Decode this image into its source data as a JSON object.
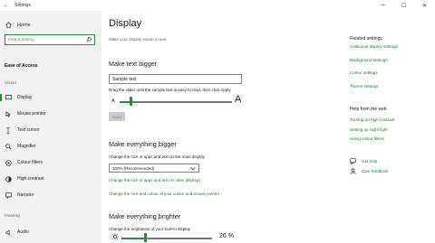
{
  "window": {
    "title": "Settings",
    "back_glyph": "←",
    "minimize_glyph": "—",
    "maximize_glyph": "☐",
    "close_glyph": "✕"
  },
  "sidebar": {
    "home_label": "Home",
    "search_placeholder": "Find a setting",
    "section_title": "Ease of Access",
    "groups": [
      {
        "label": "Vision"
      },
      {
        "label": "Hearing"
      }
    ],
    "items": [
      {
        "label": "Display",
        "icon": "display-icon",
        "active": true
      },
      {
        "label": "Mouse pointer",
        "icon": "mouse-pointer-icon"
      },
      {
        "label": "Text cursor",
        "icon": "text-cursor-icon"
      },
      {
        "label": "Magnifier",
        "icon": "magnifier-icon"
      },
      {
        "label": "Colour filters",
        "icon": "colour-filters-icon"
      },
      {
        "label": "High contrast",
        "icon": "high-contrast-icon"
      },
      {
        "label": "Narrator",
        "icon": "narrator-icon"
      },
      {
        "label": "Audio",
        "icon": "audio-icon"
      }
    ]
  },
  "main": {
    "title": "Display",
    "subtitle": "Make your display easier to see.",
    "text_bigger": {
      "heading": "Make text bigger",
      "sample_text": "Sample text",
      "instruction": "Drag the slider until the sample text is easy to read, then click Apply",
      "small_a": "A",
      "big_a": "A",
      "slider_percent": 10,
      "apply_label": "Apply"
    },
    "everything_bigger": {
      "heading": "Make everything bigger",
      "label": "Change the size of apps and text on the main display",
      "dropdown_value": "100% (Recommended)",
      "link1": "Change the size of apps and text on other displays",
      "link2": "Change the size and colour of your cursor and mouse pointer"
    },
    "everything_brighter": {
      "heading": "Make everything brighter",
      "label": "Change the brightness of your built-in display",
      "brightness_percent": 26,
      "brightness_text": "26 %"
    }
  },
  "right": {
    "related_heading": "Related settings",
    "related_links": [
      "Additional display settings",
      "Background settings",
      "Colour settings",
      "Theme settings"
    ],
    "help_heading": "Help from the web",
    "help_links": [
      "Turning on high contrast",
      "Setting up night light",
      "Using colour filters"
    ],
    "get_help": "Get help",
    "give_feedback": "Give feedback"
  },
  "colors": {
    "accent": "#1f8f3a",
    "link": "#1f7a3a",
    "sidebar_bg": "#f2f2f2"
  }
}
